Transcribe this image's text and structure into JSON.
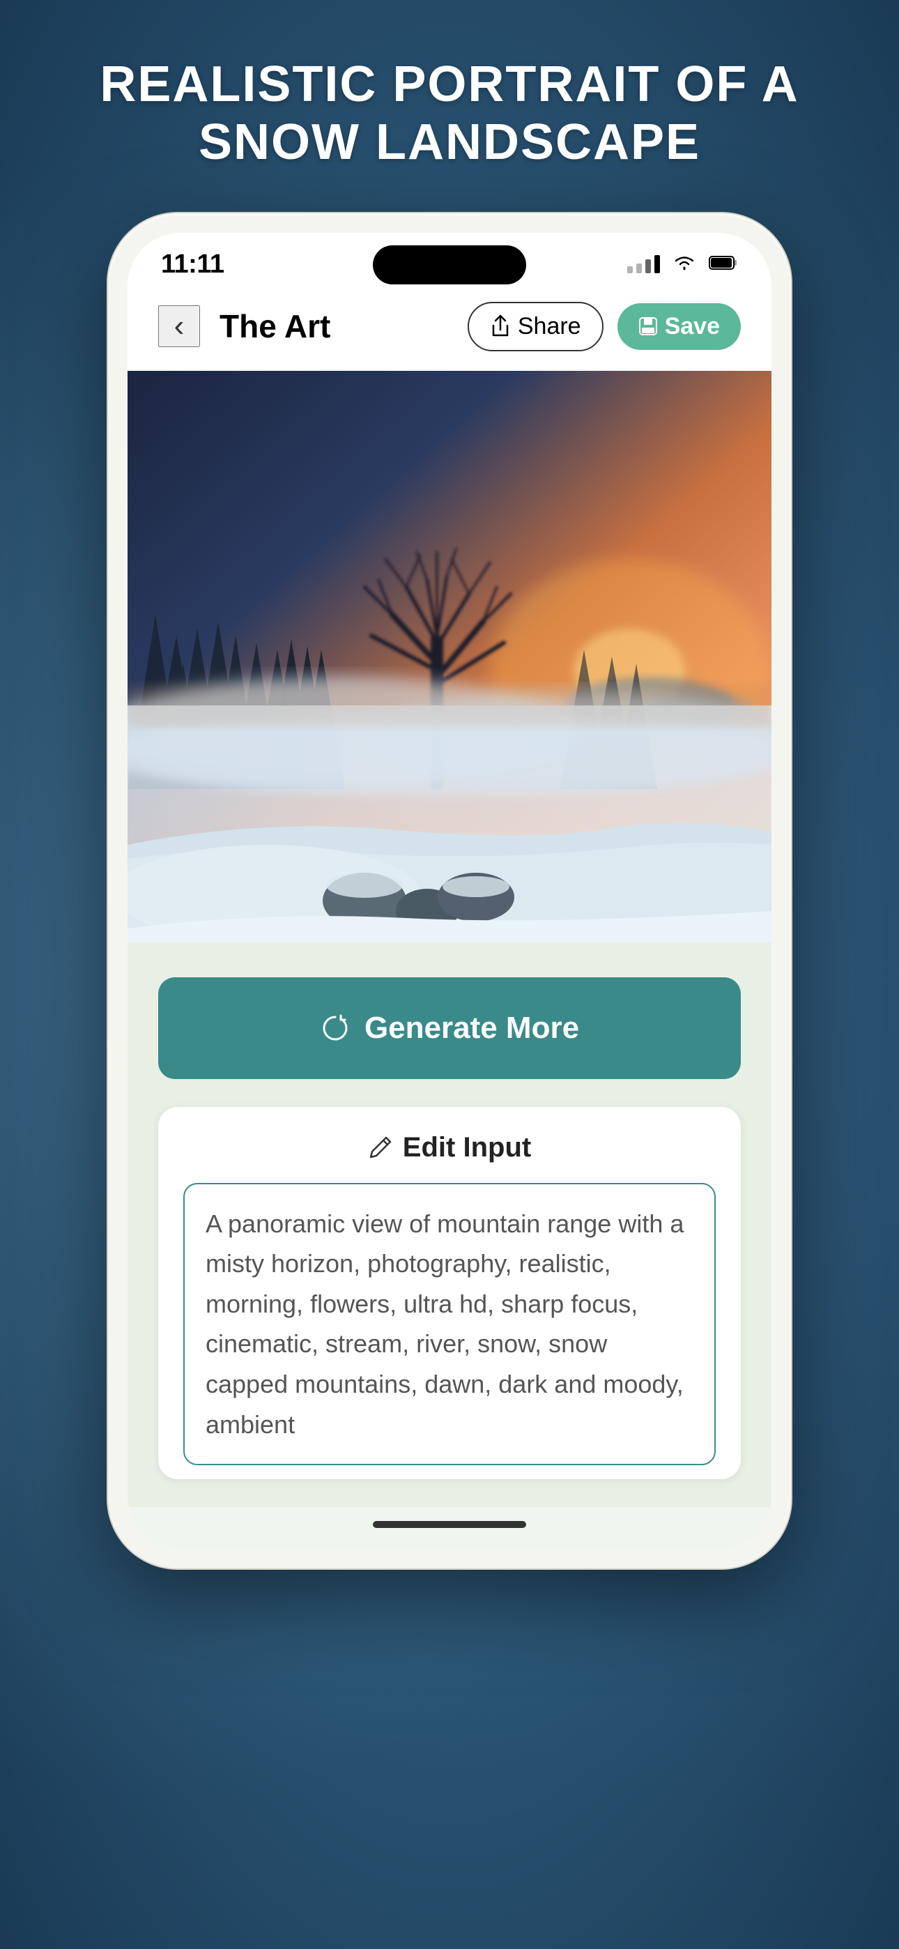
{
  "page": {
    "title": "REALISTIC PORTRAIT OF A\nSNOW LANDSCAPE",
    "background_colors": {
      "outer": "#3a6a8a",
      "phone_frame": "#f5f5f0"
    }
  },
  "status_bar": {
    "time": "11:11",
    "wifi_visible": true,
    "battery_visible": true
  },
  "nav": {
    "back_label": "‹",
    "title": "The Art",
    "share_label": "Share",
    "save_label": "Save"
  },
  "image": {
    "alt_text": "Realistic snow landscape with misty mountains and a lone tree at sunset"
  },
  "actions": {
    "generate_more_label": "Generate More"
  },
  "edit_input": {
    "section_label": "Edit Input",
    "prompt_text": "A panoramic view of mountain range with a misty horizon, photography, realistic, morning, flowers, ultra hd, sharp focus, cinematic, stream, river, snow, snow capped mountains, dawn, dark and moody, ambient"
  }
}
